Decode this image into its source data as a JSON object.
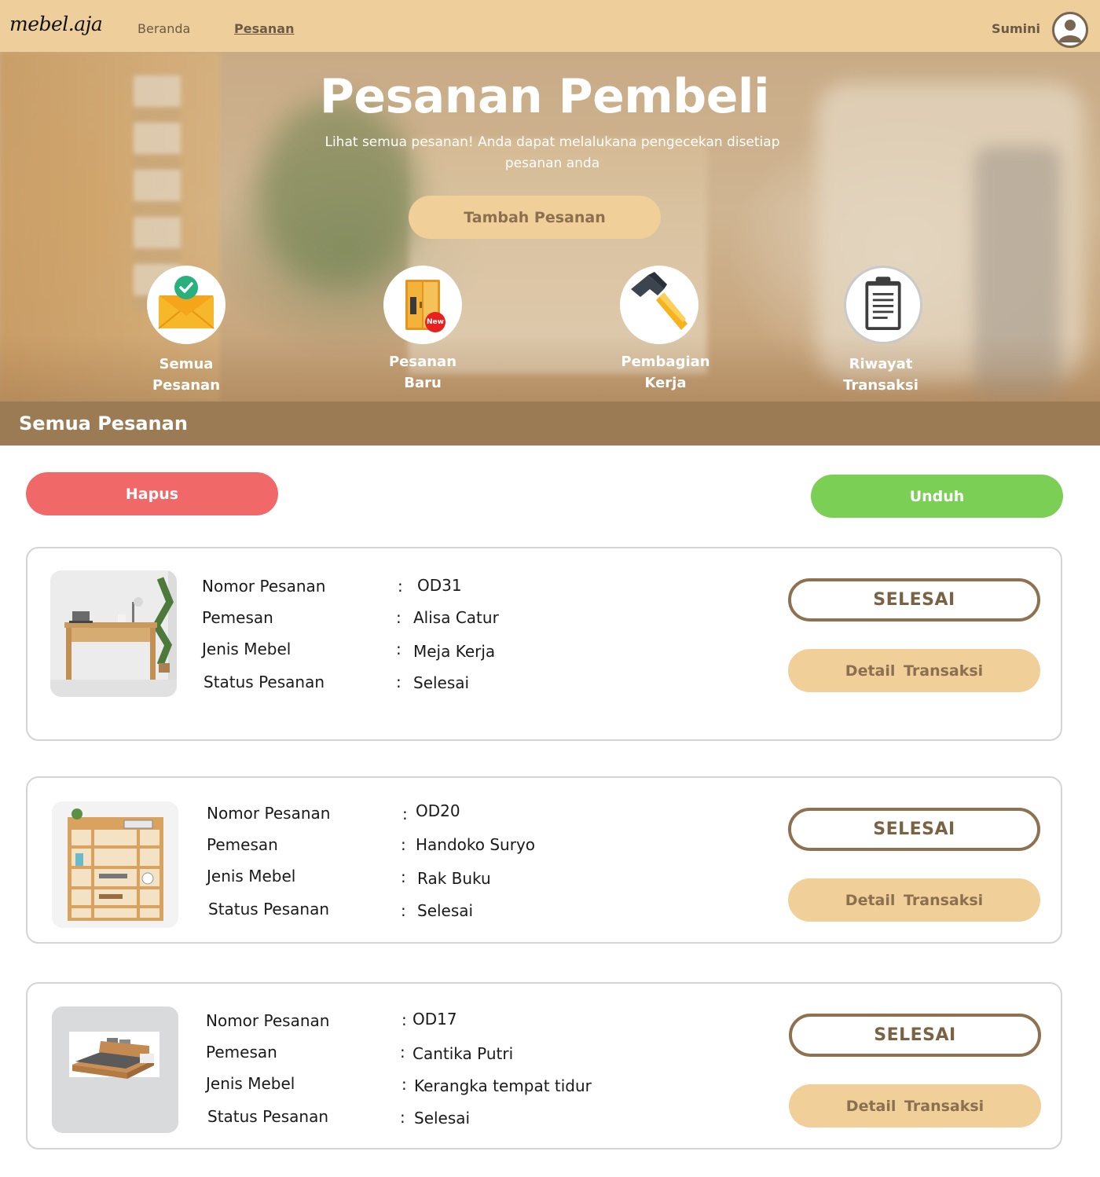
{
  "navbar": {
    "logo": "mebel.aja",
    "links": [
      {
        "label": "Beranda"
      },
      {
        "label": "Pesanan"
      }
    ],
    "user_name": "Sumini"
  },
  "hero": {
    "title": "Pesanan Pembeli",
    "subtitle": "Lihat semua pesanan! Anda dapat melalukana pengecekan disetiap pesanan anda",
    "add_button": "Tambah Pesanan",
    "categories": [
      {
        "line1": "Semua",
        "line2": "Pesanan",
        "icon": "envelope-check-icon"
      },
      {
        "line1": "Pesanan",
        "line2": "Baru",
        "icon": "new-wardrobe-icon",
        "badge": "New"
      },
      {
        "line1": "Pembagian",
        "line2": "Kerja",
        "icon": "hammer-icon"
      },
      {
        "line1": "Riwayat",
        "line2": "Transaksi",
        "icon": "clipboard-icon"
      }
    ]
  },
  "section": {
    "title": "Semua Pesanan",
    "delete_button": "Hapus",
    "download_button": "Unduh"
  },
  "field_labels": {
    "order_number": "Nomor Pesanan",
    "customer": "Pemesan",
    "furniture_type": "Jenis Mebel",
    "status": "Status Pesanan",
    "separator": ":"
  },
  "orders": [
    {
      "order_number": "OD31",
      "customer": "Alisa Catur",
      "furniture_type": "Meja Kerja",
      "status": "Selesai",
      "state_button": "SELESAI",
      "detail_button": "Detail Transaksi",
      "image": "desk-photo"
    },
    {
      "order_number": "OD20",
      "customer": "Handoko Suryo",
      "furniture_type": "Rak Buku",
      "status": "Selesai",
      "state_button": "SELESAI",
      "detail_button": "Detail Transaksi",
      "image": "bookshelf-photo"
    },
    {
      "order_number": "OD17",
      "customer": "Cantika Putri",
      "furniture_type": "Kerangka tempat tidur",
      "status": "Selesai",
      "state_button": "SELESAI",
      "detail_button": "Detail Transaksi",
      "image": "bed-frame-photo"
    }
  ],
  "colors": {
    "navbar": "#eecf9c",
    "section_bar": "#9a7b53",
    "delete": "#f06868",
    "download": "#7ccf55",
    "accent_button": "#f1cf98",
    "outline_button": "#8d7150"
  }
}
